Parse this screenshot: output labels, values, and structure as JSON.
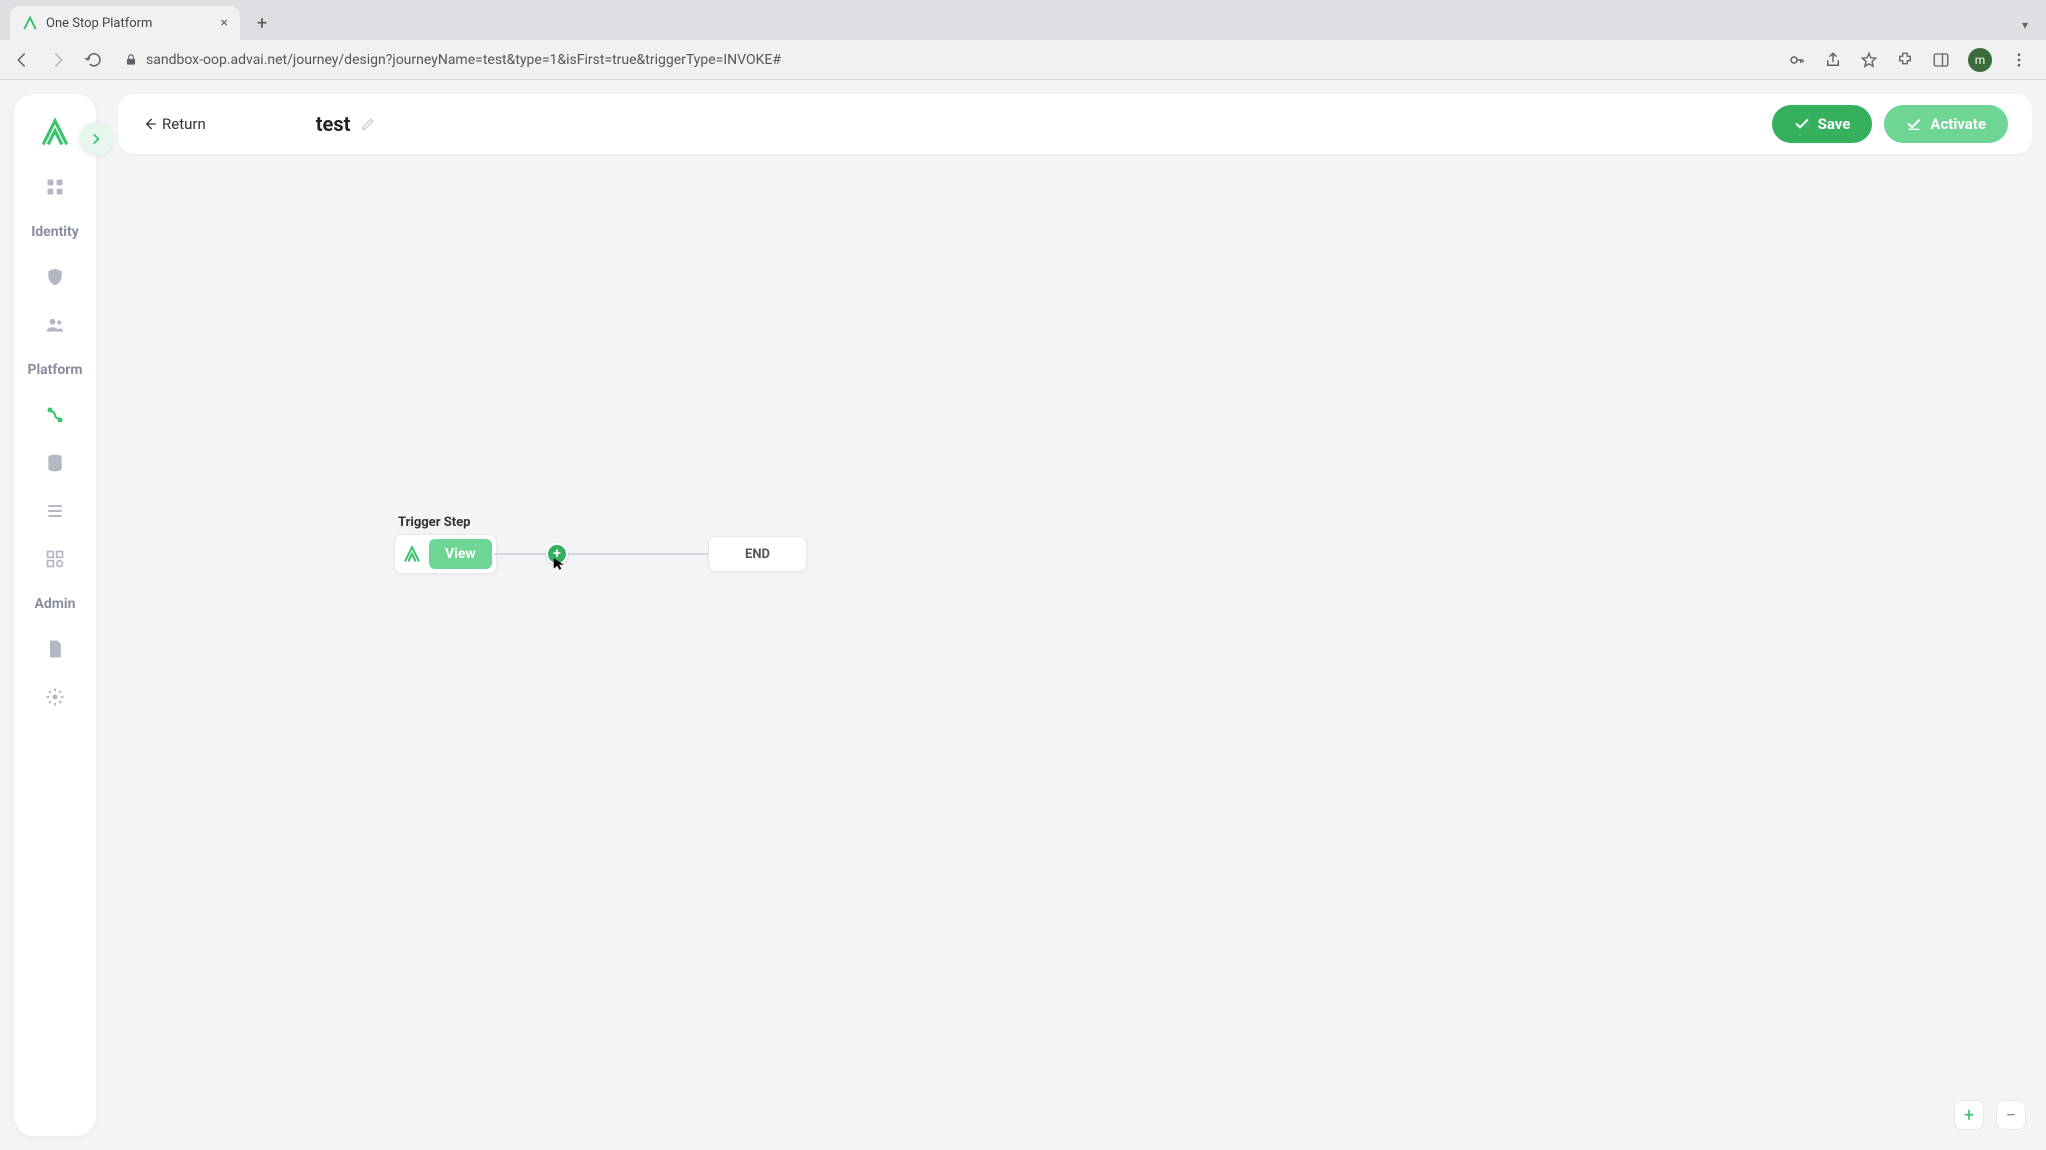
{
  "browser": {
    "tab_title": "One Stop Platform",
    "url": "sandbox-oop.advai.net/journey/design?journeyName=test&type=1&isFirst=true&triggerType=INVOKE#",
    "avatar_initial": "m"
  },
  "sidebar": {
    "sections": {
      "identity": "Identity",
      "platform": "Platform",
      "admin": "Admin"
    }
  },
  "topbar": {
    "return_label": "Return",
    "title": "test",
    "save_label": "Save",
    "activate_label": "Activate"
  },
  "canvas": {
    "trigger_label": "Trigger Step",
    "view_label": "View",
    "end_label": "END"
  }
}
